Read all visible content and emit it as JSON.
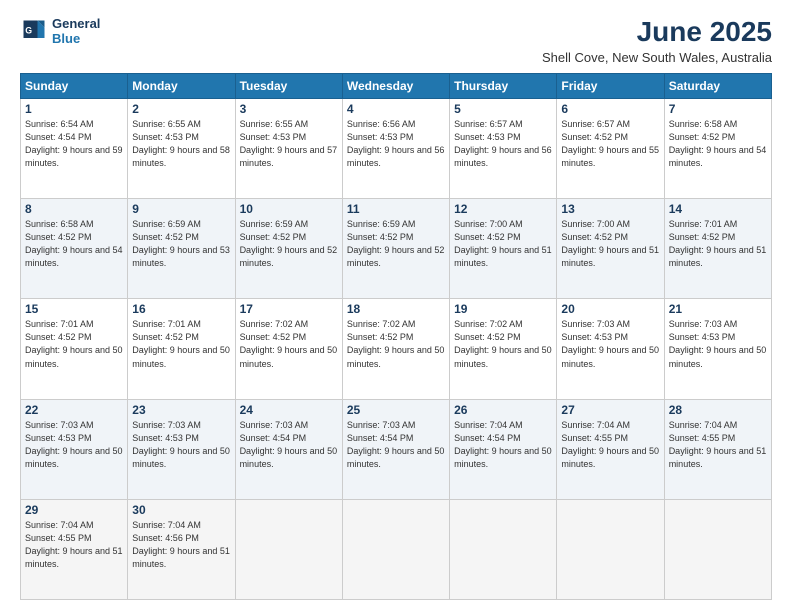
{
  "logo": {
    "line1": "General",
    "line2": "Blue"
  },
  "title": "June 2025",
  "subtitle": "Shell Cove, New South Wales, Australia",
  "header_days": [
    "Sunday",
    "Monday",
    "Tuesday",
    "Wednesday",
    "Thursday",
    "Friday",
    "Saturday"
  ],
  "weeks": [
    [
      {
        "day": "1",
        "rise": "6:54 AM",
        "set": "4:54 PM",
        "daylight": "9 hours and 59 minutes."
      },
      {
        "day": "2",
        "rise": "6:55 AM",
        "set": "4:53 PM",
        "daylight": "9 hours and 58 minutes."
      },
      {
        "day": "3",
        "rise": "6:55 AM",
        "set": "4:53 PM",
        "daylight": "9 hours and 57 minutes."
      },
      {
        "day": "4",
        "rise": "6:56 AM",
        "set": "4:53 PM",
        "daylight": "9 hours and 56 minutes."
      },
      {
        "day": "5",
        "rise": "6:57 AM",
        "set": "4:53 PM",
        "daylight": "9 hours and 56 minutes."
      },
      {
        "day": "6",
        "rise": "6:57 AM",
        "set": "4:52 PM",
        "daylight": "9 hours and 55 minutes."
      },
      {
        "day": "7",
        "rise": "6:58 AM",
        "set": "4:52 PM",
        "daylight": "9 hours and 54 minutes."
      }
    ],
    [
      {
        "day": "8",
        "rise": "6:58 AM",
        "set": "4:52 PM",
        "daylight": "9 hours and 54 minutes."
      },
      {
        "day": "9",
        "rise": "6:59 AM",
        "set": "4:52 PM",
        "daylight": "9 hours and 53 minutes."
      },
      {
        "day": "10",
        "rise": "6:59 AM",
        "set": "4:52 PM",
        "daylight": "9 hours and 52 minutes."
      },
      {
        "day": "11",
        "rise": "6:59 AM",
        "set": "4:52 PM",
        "daylight": "9 hours and 52 minutes."
      },
      {
        "day": "12",
        "rise": "7:00 AM",
        "set": "4:52 PM",
        "daylight": "9 hours and 51 minutes."
      },
      {
        "day": "13",
        "rise": "7:00 AM",
        "set": "4:52 PM",
        "daylight": "9 hours and 51 minutes."
      },
      {
        "day": "14",
        "rise": "7:01 AM",
        "set": "4:52 PM",
        "daylight": "9 hours and 51 minutes."
      }
    ],
    [
      {
        "day": "15",
        "rise": "7:01 AM",
        "set": "4:52 PM",
        "daylight": "9 hours and 50 minutes."
      },
      {
        "day": "16",
        "rise": "7:01 AM",
        "set": "4:52 PM",
        "daylight": "9 hours and 50 minutes."
      },
      {
        "day": "17",
        "rise": "7:02 AM",
        "set": "4:52 PM",
        "daylight": "9 hours and 50 minutes."
      },
      {
        "day": "18",
        "rise": "7:02 AM",
        "set": "4:52 PM",
        "daylight": "9 hours and 50 minutes."
      },
      {
        "day": "19",
        "rise": "7:02 AM",
        "set": "4:52 PM",
        "daylight": "9 hours and 50 minutes."
      },
      {
        "day": "20",
        "rise": "7:03 AM",
        "set": "4:53 PM",
        "daylight": "9 hours and 50 minutes."
      },
      {
        "day": "21",
        "rise": "7:03 AM",
        "set": "4:53 PM",
        "daylight": "9 hours and 50 minutes."
      }
    ],
    [
      {
        "day": "22",
        "rise": "7:03 AM",
        "set": "4:53 PM",
        "daylight": "9 hours and 50 minutes."
      },
      {
        "day": "23",
        "rise": "7:03 AM",
        "set": "4:53 PM",
        "daylight": "9 hours and 50 minutes."
      },
      {
        "day": "24",
        "rise": "7:03 AM",
        "set": "4:54 PM",
        "daylight": "9 hours and 50 minutes."
      },
      {
        "day": "25",
        "rise": "7:03 AM",
        "set": "4:54 PM",
        "daylight": "9 hours and 50 minutes."
      },
      {
        "day": "26",
        "rise": "7:04 AM",
        "set": "4:54 PM",
        "daylight": "9 hours and 50 minutes."
      },
      {
        "day": "27",
        "rise": "7:04 AM",
        "set": "4:55 PM",
        "daylight": "9 hours and 50 minutes."
      },
      {
        "day": "28",
        "rise": "7:04 AM",
        "set": "4:55 PM",
        "daylight": "9 hours and 51 minutes."
      }
    ],
    [
      {
        "day": "29",
        "rise": "7:04 AM",
        "set": "4:55 PM",
        "daylight": "9 hours and 51 minutes."
      },
      {
        "day": "30",
        "rise": "7:04 AM",
        "set": "4:56 PM",
        "daylight": "9 hours and 51 minutes."
      },
      null,
      null,
      null,
      null,
      null
    ]
  ]
}
